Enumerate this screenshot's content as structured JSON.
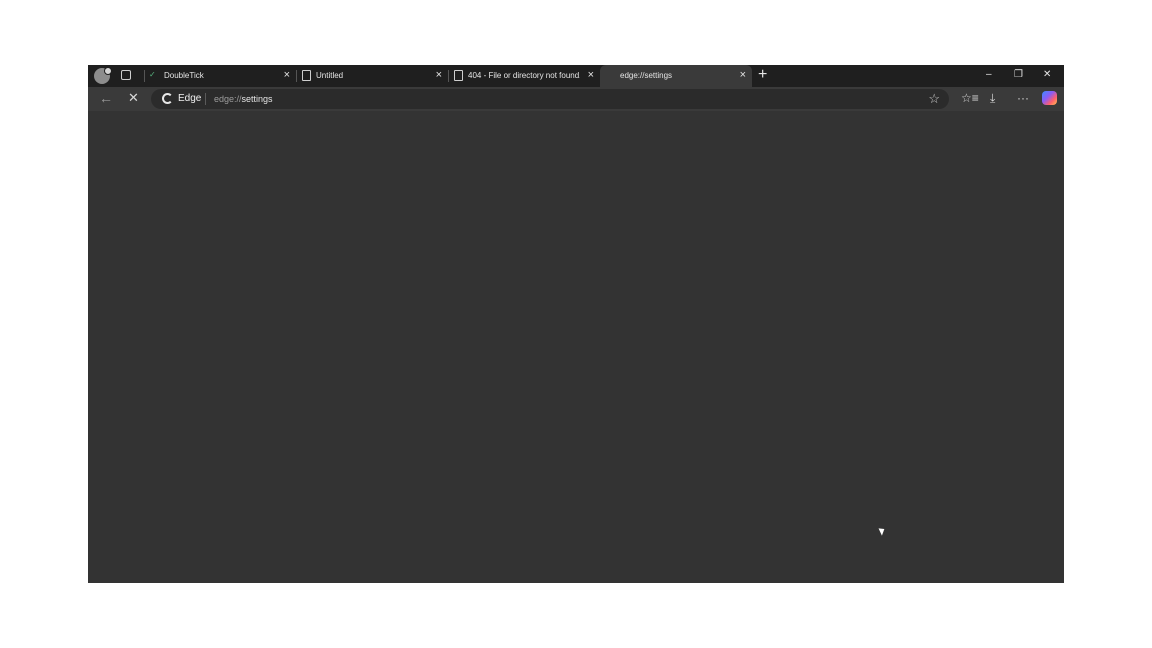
{
  "tabs": [
    {
      "label": "DoubleTick",
      "favicon": "doubletick-icon"
    },
    {
      "label": "Untitled",
      "favicon": "page-icon"
    },
    {
      "label": "404 - File or directory not found.",
      "favicon": "page-icon"
    },
    {
      "label": "edge://settings",
      "favicon": "loading-icon",
      "active": true
    }
  ],
  "tab_close": "×",
  "new_tab": "+",
  "window": {
    "minimize": "–",
    "restore": "❐",
    "close": "✕"
  },
  "toolbar": {
    "back": "←",
    "stop": "✕",
    "site_label": "Edge",
    "url_scheme": "edge://",
    "url_host": "settings",
    "favorite": "☆",
    "favorites_bar": "☆≡",
    "downloads": "⤓",
    "more": "···"
  },
  "colors": {
    "titlebar": "#1f1f1f",
    "toolbar": "#3a3a3a",
    "content": "#333333"
  }
}
